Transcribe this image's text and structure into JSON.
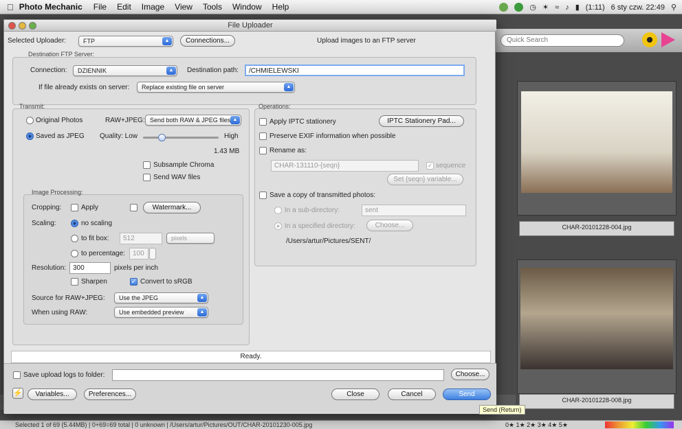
{
  "menubar": {
    "app": "Photo Mechanic",
    "items": [
      "File",
      "Edit",
      "Image",
      "View",
      "Tools",
      "Window",
      "Help"
    ],
    "battery": "(1:11)",
    "clock": "6 sty czw. 22:49"
  },
  "background": {
    "search_placeholder": "Quick Search",
    "thumbs": [
      "CHAR-20101228-004.jpg",
      "CHAR-20101228-008.jpg"
    ],
    "status": "Selected 1 of 69 (5.44MB) | 0+69=69 total | 0 unknown | /Users/artur/Pictures/OUT/CHAR-20101230-005.jpg",
    "stars": "0★ 1★ 2★ 3★ 4★ 5★"
  },
  "dialog": {
    "title": "File Uploader",
    "uploader_label": "Selected Uploader:",
    "uploader_value": "FTP",
    "connections_btn": "Connections...",
    "description": "Upload images to an FTP server",
    "dest_group": "Destination FTP Server:",
    "connection_label": "Connection:",
    "connection_value": "DZIENNIK",
    "dest_path_label": "Destination path:",
    "dest_path_value": "/CHMIELEWSKI",
    "exists_label": "If file already exists on server:",
    "exists_value": "Replace existing file on server",
    "transmit_group": "Transmit:",
    "original_photos": "Original Photos",
    "rawjpeg_label": "RAW+JPEG:",
    "rawjpeg_value": "Send both RAW & JPEG files",
    "saved_jpeg": "Saved as JPEG",
    "quality_label": "Quality: Low",
    "quality_high": "High",
    "size": "1.43 MB",
    "subsample": "Subsample Chroma",
    "send_wav": "Send WAV files",
    "imgproc_group": "Image Processing:",
    "cropping_label": "Cropping:",
    "apply": "Apply",
    "watermark_btn": "Watermark...",
    "scaling_label": "Scaling:",
    "no_scaling": "no scaling",
    "fit_box": "to fit box:",
    "fit_value": "512",
    "fit_unit": "pixels",
    "percentage": "to percentage:",
    "percentage_value": "100",
    "resolution_label": "Resolution:",
    "resolution_value": "300",
    "resolution_unit": "pixels per inch",
    "sharpen": "Sharpen",
    "convert_srgb": "Convert to sRGB",
    "source_raw_label": "Source for RAW+JPEG:",
    "source_raw_value": "Use the JPEG",
    "when_raw_label": "When using RAW:",
    "when_raw_value": "Use embedded preview",
    "operations_group": "Operations:",
    "apply_iptc": "Apply IPTC stationery",
    "iptc_btn": "IPTC Stationery Pad...",
    "preserve_exif": "Preserve EXIF information when possible",
    "rename_as": "Rename as:",
    "rename_value": "CHAR-131110-{seqn}",
    "sequence": "sequence",
    "set_seqn_btn": "Set {seqn} variable...",
    "save_copy": "Save a copy of transmitted photos:",
    "in_subdir": "In a sub-directory:",
    "subdir_value": "sent",
    "in_specified": "In a specified directory:",
    "choose_btn": "Choose...",
    "copy_path": "/Users/artur/Pictures/SENT/",
    "status": "Ready.",
    "save_logs": "Save upload logs to folder:",
    "logs_choose_btn": "Choose...",
    "variables_btn": "Variables...",
    "preferences_btn": "Preferences...",
    "close_btn": "Close",
    "cancel_btn": "Cancel",
    "send_btn": "Send",
    "tooltip": "Send (Return)"
  }
}
